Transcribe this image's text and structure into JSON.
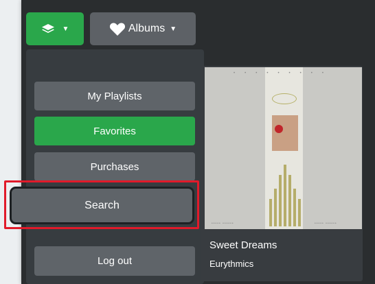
{
  "toolbar": {
    "layers_icon": "layers-icon",
    "albums_label": "Albums",
    "albums_icon": "heart-icon"
  },
  "menu": {
    "items": [
      {
        "label": "My Playlists",
        "active": false
      },
      {
        "label": "Favorites",
        "active": true
      },
      {
        "label": "Purchases",
        "active": false
      },
      {
        "label": "Search",
        "active": false,
        "highlighted": true
      },
      {
        "label": "Log out",
        "active": false
      }
    ]
  },
  "album": {
    "title": "Sweet Dreams",
    "artist": "Eurythmics"
  },
  "colors": {
    "accent_green": "#2aa74b",
    "button_gray": "#5f6469",
    "highlight_red": "#e11a2a",
    "background_dark": "#2a2d2f"
  }
}
